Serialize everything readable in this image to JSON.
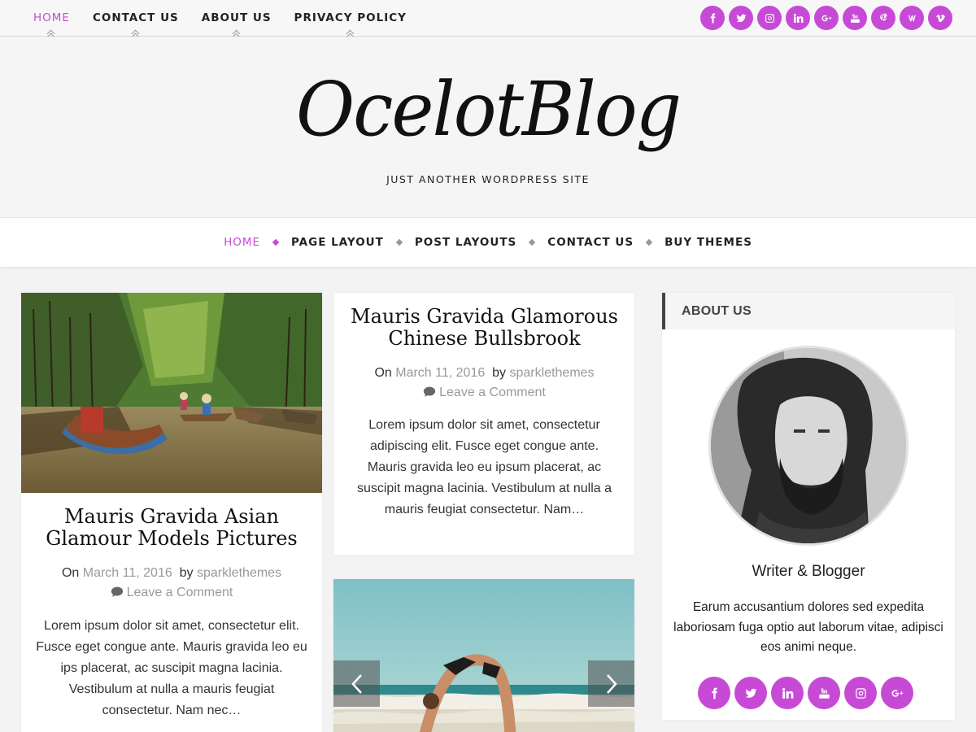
{
  "top_nav": {
    "items": [
      {
        "label": "HOME",
        "active": true
      },
      {
        "label": "CONTACT US",
        "active": false
      },
      {
        "label": "ABOUT US",
        "active": false
      },
      {
        "label": "PRIVACY POLICY",
        "active": false
      }
    ]
  },
  "top_social": [
    "facebook-icon",
    "twitter-icon",
    "instagram-icon",
    "linkedin-icon",
    "google-plus-icon",
    "youtube-icon",
    "pinterest-icon",
    "vine-like-icon",
    "vimeo-icon"
  ],
  "header": {
    "site_title": "OcelotBlog",
    "tagline": "JUST ANOTHER WORDPRESS SITE"
  },
  "main_nav": {
    "items": [
      {
        "label": "HOME",
        "active": true
      },
      {
        "label": "PAGE LAYOUT",
        "active": false
      },
      {
        "label": "POST LAYOUTS",
        "active": false
      },
      {
        "label": "CONTACT US",
        "active": false
      },
      {
        "label": "BUY THEMES",
        "active": false
      }
    ]
  },
  "posts": [
    {
      "title": "Mauris Gravida Asian Glamour Models Pictures",
      "on": "On",
      "date": "March 11, 2016",
      "by": "by",
      "author": "sparklethemes",
      "comment": "Leave a Comment",
      "excerpt": "Lorem ipsum dolor sit amet, consectetur elit. Fusce eget congue ante.  Mauris gravida leo eu ips placerat, ac suscipit magna lacinia. Vestibulum at nulla a mauris feugiat consectetur. Nam nec…"
    },
    {
      "title": "Mauris Gravida Glamorous Chinese Bullsbrook",
      "on": "On",
      "date": "March 11, 2016",
      "by": "by",
      "author": "sparklethemes",
      "comment": "Leave a Comment",
      "excerpt": "Lorem ipsum dolor sit amet, consectetur adipiscing elit. Fusce eget congue ante. Mauris gravida leo eu ipsum placerat, ac suscipit magna lacinia. Vestibulum at nulla a mauris feugiat consectetur. Nam…"
    }
  ],
  "sidebar": {
    "widget_title": "ABOUT US",
    "role": "Writer & Blogger",
    "bio": "Earum accusantium dolores sed expedita laboriosam fuga optio aut laborum vitae, adipisci eos animi neque.",
    "social": [
      "facebook-icon",
      "twitter-icon",
      "linkedin-icon",
      "youtube-icon",
      "instagram-icon",
      "google-plus-icon"
    ]
  },
  "colors": {
    "accent": "#c74ad6",
    "text": "#222222",
    "muted": "#999999"
  }
}
